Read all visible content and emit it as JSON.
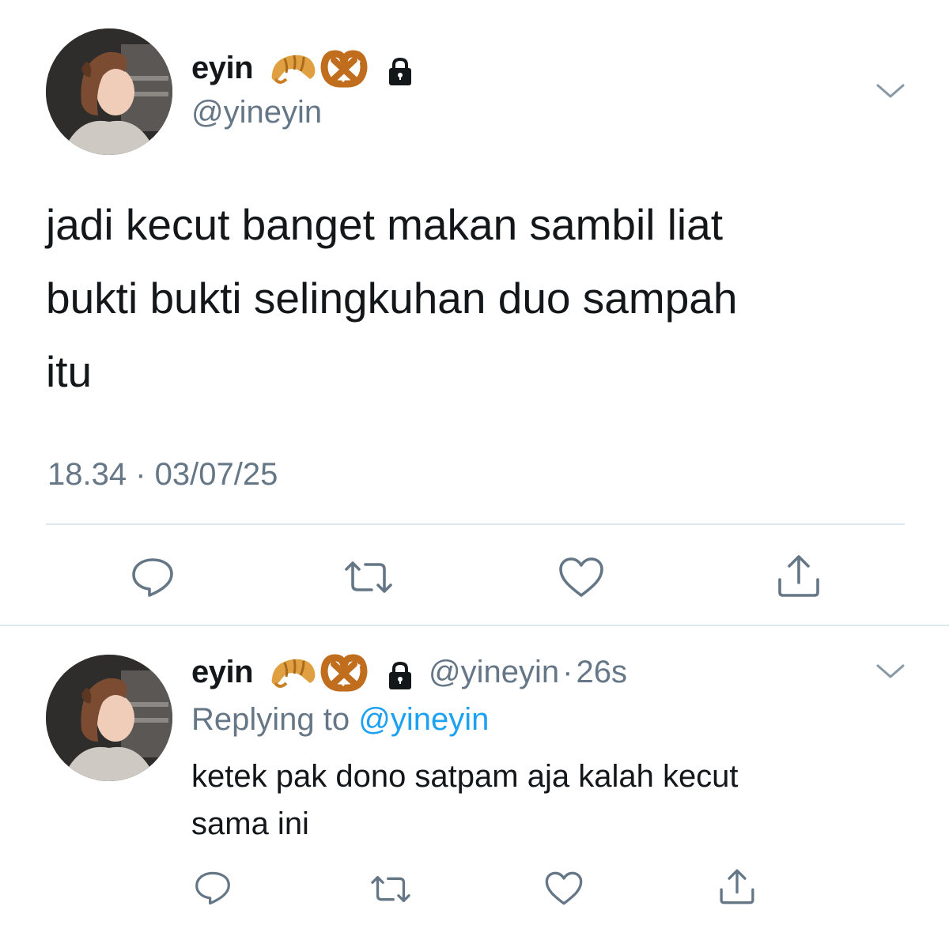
{
  "main_tweet": {
    "display_name": "eyin",
    "name_emojis": [
      "croissant-emoji",
      "pretzel-emoji"
    ],
    "protected_icon": "lock-icon",
    "handle": "@yineyin",
    "text": "jadi kecut banget makan sambil liat\nbukti bukti selingkuhan duo sampah\nitu",
    "timestamp": "18.34 · 03/07/25",
    "actions": [
      "reply-icon",
      "retweet-icon",
      "like-icon",
      "share-icon"
    ]
  },
  "reply_tweet": {
    "display_name": "eyin",
    "name_emojis": [
      "croissant-emoji",
      "pretzel-emoji"
    ],
    "protected_icon": "lock-icon",
    "handle": "@yineyin",
    "separator": "·",
    "age": "26s",
    "replying_to_label": "Replying to",
    "replying_to_handle": "@yineyin",
    "text": "ketek pak dono satpam aja kalah kecut\nsama ini",
    "actions": [
      "reply-icon",
      "retweet-icon",
      "like-icon",
      "share-icon"
    ]
  },
  "colors": {
    "text": "#14171a",
    "secondary": "#657786",
    "link": "#1da1f2",
    "divider": "#e1e8ed"
  }
}
